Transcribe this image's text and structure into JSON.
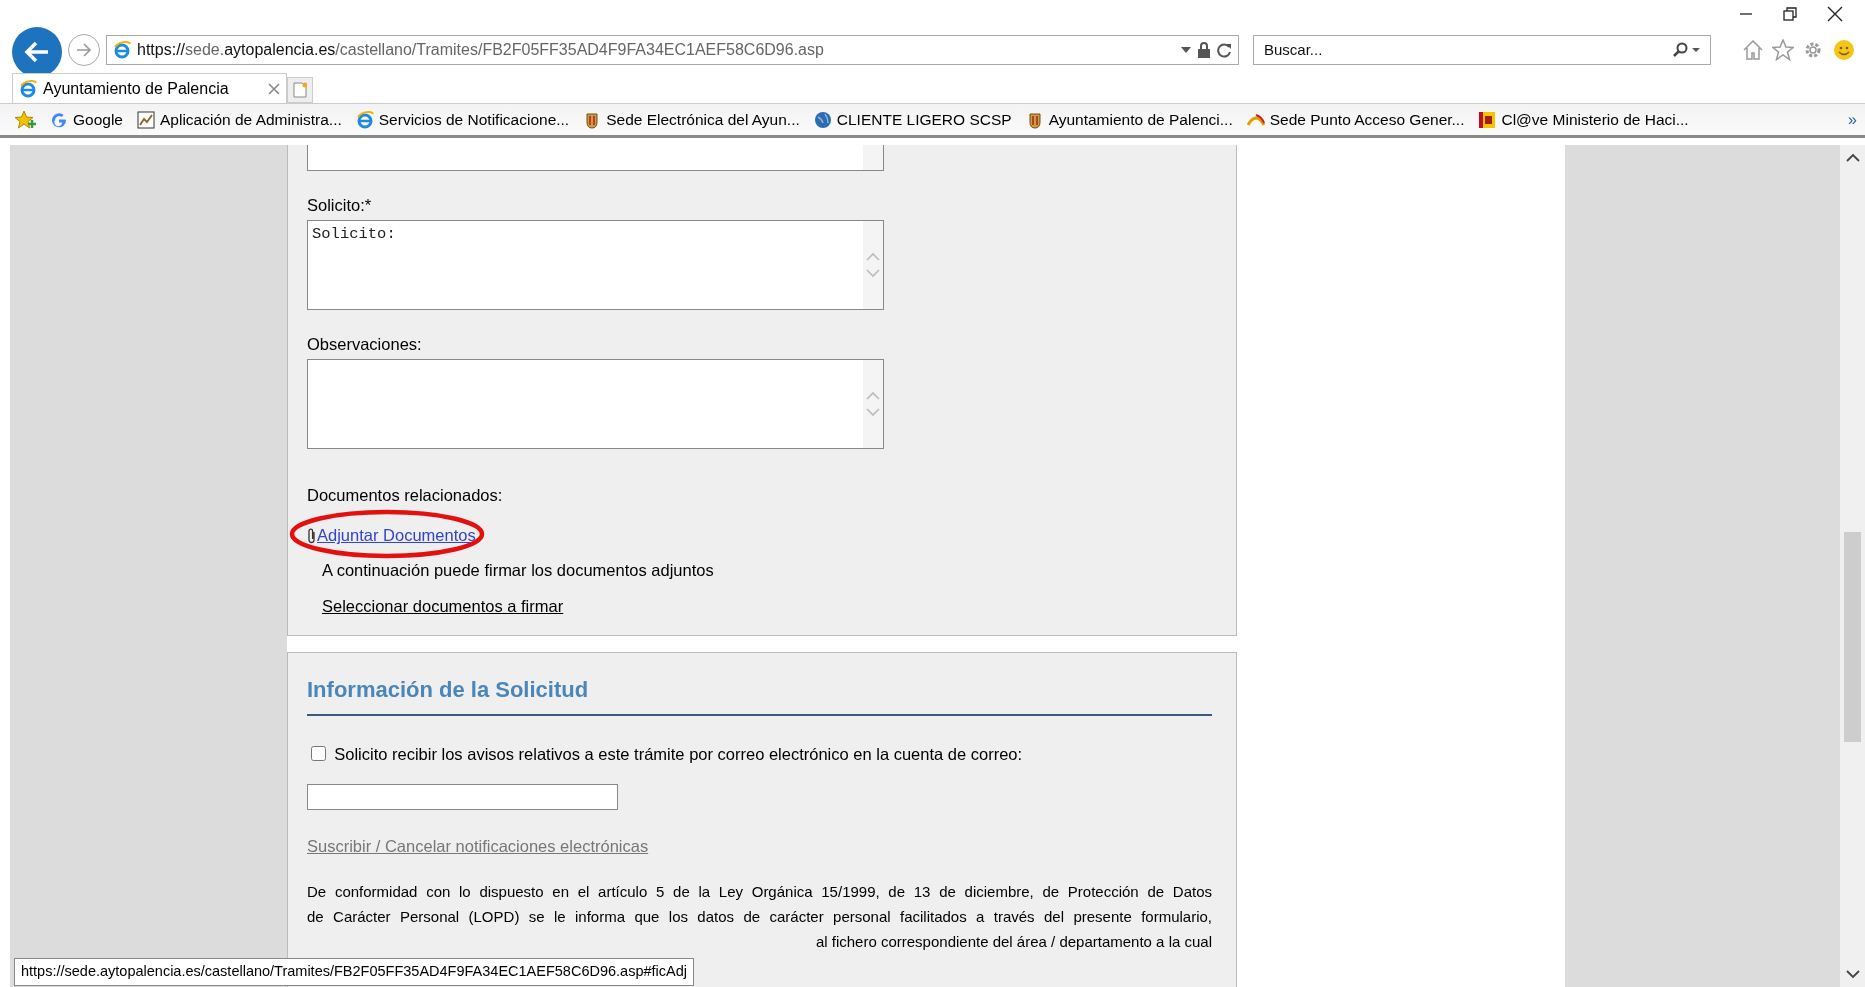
{
  "browser": {
    "url_scheme": "https://",
    "url_sub": "sede.",
    "url_domain": "aytopalencia.es",
    "url_path": "/castellano/Tramites/FB2F05FF35AD4F9FA34EC1AEF58C6D96.asp",
    "search": {
      "placeholder": "Buscar..."
    },
    "tabs": [
      {
        "label": "Ayuntamiento de Palencia",
        "selected": true
      }
    ],
    "favorites": [
      {
        "kind": "google",
        "label": "Google"
      },
      {
        "kind": "app",
        "label": "Aplicación de Administra..."
      },
      {
        "kind": "ie",
        "label": "Servicios de Notificacione..."
      },
      {
        "kind": "crest",
        "label": "Sede Electrónica del Ayun..."
      },
      {
        "kind": "globe",
        "label": "CLIENTE LIGERO SCSP"
      },
      {
        "kind": "crest",
        "label": "Ayuntamiento de Palenci..."
      },
      {
        "kind": "gob",
        "label": "Sede Punto Acceso Gener..."
      },
      {
        "kind": "flag",
        "label": "Cl@ve Ministerio de Haci..."
      }
    ],
    "more": "»"
  },
  "form": {
    "fields": [
      {
        "kind": "clipped"
      },
      {
        "kind": "textarea",
        "label": "Solicito:*",
        "value": "Solicito:"
      },
      {
        "kind": "textarea",
        "label": "Observaciones:"
      }
    ],
    "documents": {
      "label": "Documentos relacionados:",
      "attach_link": "Adjuntar Documentos",
      "sign_note": "A continuación puede firmar los documentos adjuntos",
      "select_link": "Seleccionar documentos a firmar"
    }
  },
  "info": {
    "title": "Información de la Solicitud",
    "email_opt_in": {
      "label": "Solicito recibir los avisos relativos a este trámite por correo electrónico en la cuenta de correo:",
      "checked": false
    },
    "subscribe_link": "Suscribir / Cancelar notificaciones electrónicas",
    "legal_lines": [
      "De conformidad con lo dispuesto en el artículo 5 de la Ley Orgánica 15/1999, de 13 de diciembre, de Protección de Datos",
      "de Carácter Personal (LOPD) se le informa que los datos de carácter personal facilitados a través del presente formulario,"
    ],
    "legal_tail": "al fichero correspondiente del área / departamento a la cual"
  },
  "status_bar": {
    "url": "https://sede.aytopalencia.es/castellano/Tramites/FB2F05FF35AD4F9FA34EC1AEF58C6D96.asp#ficAdj"
  },
  "annotations": [
    {
      "kind": "ellipse"
    }
  ]
}
